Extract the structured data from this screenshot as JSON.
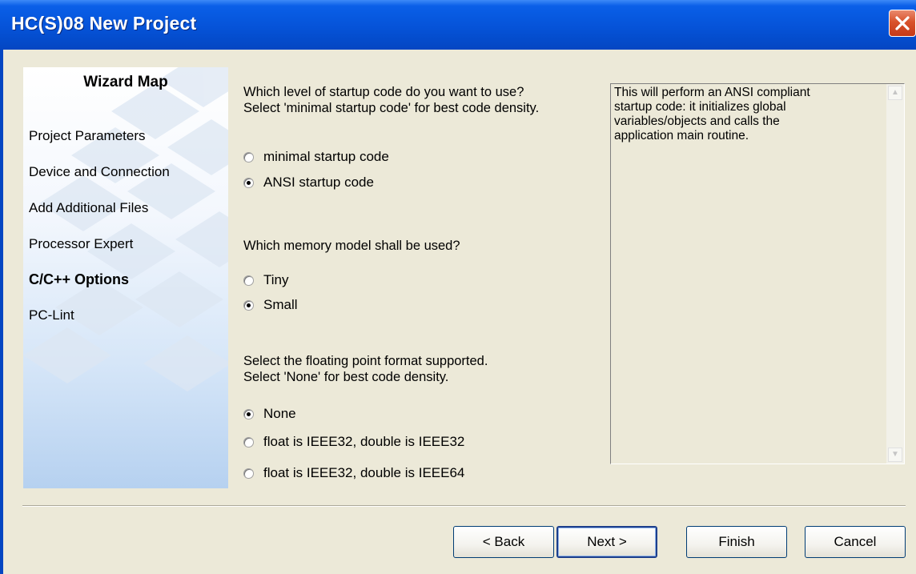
{
  "window": {
    "title": "HC(S)08 New Project"
  },
  "wizard_map": {
    "title": "Wizard Map",
    "items": [
      {
        "label": "Project Parameters",
        "active": false
      },
      {
        "label": "Device and Connection",
        "active": false
      },
      {
        "label": "Add Additional Files",
        "active": false
      },
      {
        "label": "Processor Expert",
        "active": false
      },
      {
        "label": "C/C++ Options",
        "active": true
      },
      {
        "label": "PC-Lint",
        "active": false
      }
    ]
  },
  "startup": {
    "question_line1": "Which level of startup code do you want to use?",
    "question_line2": "Select 'minimal startup code' for best code density.",
    "options": [
      {
        "label": "minimal startup code",
        "selected": false
      },
      {
        "label": "ANSI startup code",
        "selected": true
      }
    ]
  },
  "memory": {
    "question": "Which memory model shall be used?",
    "options": [
      {
        "label": "Tiny",
        "selected": false
      },
      {
        "label": "Small",
        "selected": true
      }
    ]
  },
  "floating": {
    "question_line1": "Select the floating point format supported.",
    "question_line2": "Select 'None' for best code density.",
    "options": [
      {
        "label": "None",
        "selected": true
      },
      {
        "label": "float is IEEE32, double is IEEE32",
        "selected": false
      },
      {
        "label": "float is IEEE32, double is IEEE64",
        "selected": false
      }
    ]
  },
  "description": {
    "line1": "This will perform an ANSI compliant",
    "line2": "startup code: it initializes global",
    "line3": "variables/objects and calls the",
    "line4": "application main routine."
  },
  "buttons": {
    "back": "< Back",
    "next": "Next >",
    "finish": "Finish",
    "cancel": "Cancel"
  },
  "colors": {
    "titlebar": "#0553d8",
    "dialog_bg": "#ece9d8",
    "close_button": "#d9522b"
  }
}
